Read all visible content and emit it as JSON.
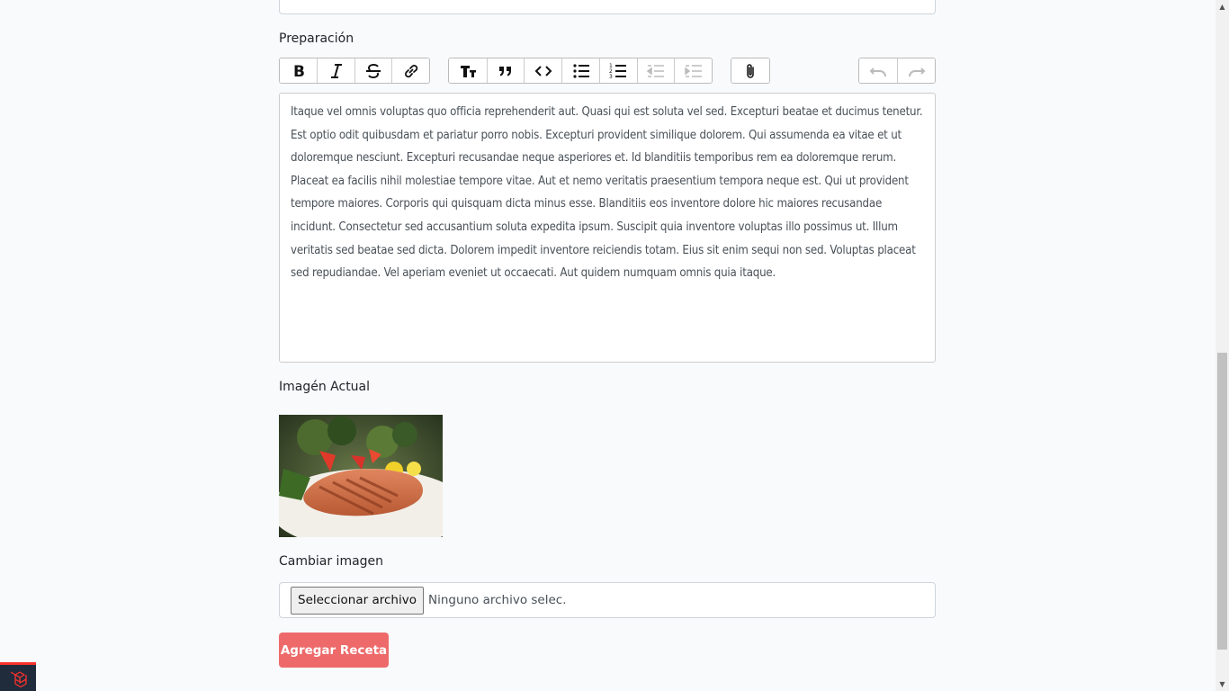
{
  "form": {
    "preparation_label": "Preparación",
    "preparation_text": "Itaque vel omnis voluptas quo officia reprehenderit aut. Quasi qui est soluta vel sed. Excepturi beatae et ducimus tenetur. Est optio odit quibusdam et pariatur porro nobis. Excepturi provident similique dolorem. Qui assumenda ea vitae et ut doloremque nesciunt. Excepturi recusandae neque asperiores et. Id blanditiis temporibus rem ea doloremque rerum. Placeat ea facilis nihil molestiae tempore vitae. Aut et nemo veritatis praesentium tempora neque est. Qui ut provident tempore maiores. Corporis qui quisquam dicta minus esse. Blanditiis eos inventore dolore hic maiores recusandae incidunt. Consectetur sed accusantium soluta expedita ipsum. Suscipit quia inventore voluptas illo possimus ut. Illum veritatis sed beatae sed dicta. Dolorem impedit inventore reiciendis totam. Eius sit enim sequi non sed. Voluptas placeat sed repudiandae. Vel aperiam eveniet ut occaecati. Aut quidem numquam omnis quia itaque.",
    "current_image_label": "Imagén Actual",
    "change_image_label": "Cambiar imagen",
    "file_button_label": "Seleccionar archivo",
    "file_status": "Ninguno archivo selec.",
    "submit_label": "Agregar Receta"
  },
  "toolbar": {
    "text_tools": [
      "bold-icon",
      "italic-icon",
      "strikethrough-icon",
      "link-icon"
    ],
    "block_tools": [
      "heading-icon",
      "quote-icon",
      "code-icon",
      "bullet-list-icon",
      "numbered-list-icon",
      "decrease-indent-icon",
      "increase-indent-icon"
    ],
    "file_tools": [
      "attach-icon"
    ],
    "history_tools": [
      "undo-icon",
      "redo-icon"
    ]
  },
  "colors": {
    "submit_button": "#ee6a6a",
    "background": "#f8fafc",
    "badge": "#202b3c",
    "badge_accent": "#f9322c"
  }
}
